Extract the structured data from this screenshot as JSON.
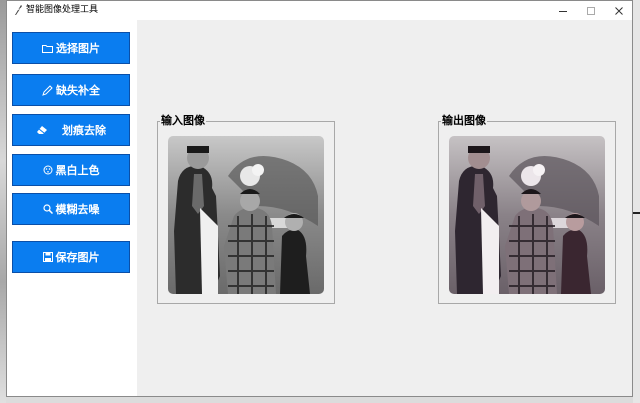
{
  "window": {
    "title": "智能图像处理工具"
  },
  "sidebar": {
    "buttons": [
      {
        "label": "选择图片",
        "icon": "folder-icon"
      },
      {
        "label": "缺失补全",
        "icon": "brush-icon"
      },
      {
        "label": "划痕去除",
        "icon": "eraser-icon"
      },
      {
        "label": "黑白上色",
        "icon": "palette-icon"
      },
      {
        "label": "模糊去噪",
        "icon": "magnifier-icon"
      },
      {
        "label": "保存图片",
        "icon": "save-icon"
      }
    ]
  },
  "main": {
    "input_frame_label": "输入图像",
    "output_frame_label": "输出图像"
  },
  "colors": {
    "button_bg": "#0a7df0",
    "sidebar_bg": "#ffffff",
    "main_bg": "#efefef"
  }
}
